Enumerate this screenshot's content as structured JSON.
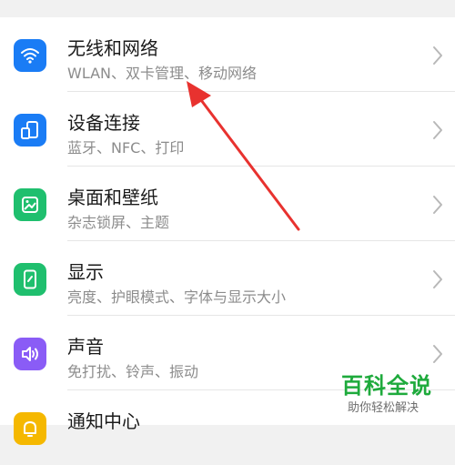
{
  "settings": {
    "items": [
      {
        "title": "无线和网络",
        "subtitle": "WLAN、双卡管理、移动网络",
        "icon": "wifi-icon",
        "color": "#1a7cf5"
      },
      {
        "title": "设备连接",
        "subtitle": "蓝牙、NFC、打印",
        "icon": "device-connect-icon",
        "color": "#1a7cf5"
      },
      {
        "title": "桌面和壁纸",
        "subtitle": "杂志锁屏、主题",
        "icon": "wallpaper-icon",
        "color": "#1fbf6e"
      },
      {
        "title": "显示",
        "subtitle": "亮度、护眼模式、字体与显示大小",
        "icon": "display-icon",
        "color": "#1fbf6e"
      },
      {
        "title": "声音",
        "subtitle": "免打扰、铃声、振动",
        "icon": "speaker-icon",
        "color": "#8a5cf6"
      },
      {
        "title": "通知中心",
        "subtitle": "",
        "icon": "notification-icon",
        "color": "#f5b800"
      }
    ]
  },
  "watermark": {
    "main": "百科全说",
    "sub": "助你轻松解决"
  },
  "annotation": {
    "arrow_color": "#e8322f"
  }
}
